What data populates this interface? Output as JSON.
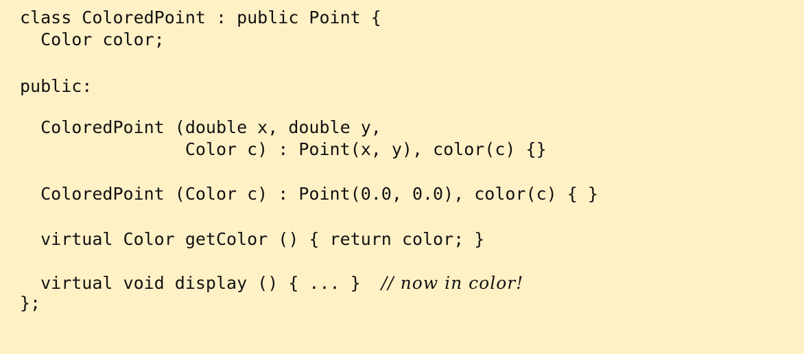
{
  "code": {
    "lines": [
      "class ColoredPoint : public Point {",
      "  Color color;",
      "public:",
      "  ColoredPoint (double x, double y,",
      "                Color c) : Point(x, y), color(c) {}",
      "  ColoredPoint (Color c) : Point(0.0, 0.0), color(c) { }",
      "  virtual Color getColor () { return color; }",
      "  virtual void display () { ... }",
      "};"
    ],
    "comment": "// now in color!",
    "colors": {
      "background": "#fff1c6",
      "text": "#111111"
    }
  }
}
